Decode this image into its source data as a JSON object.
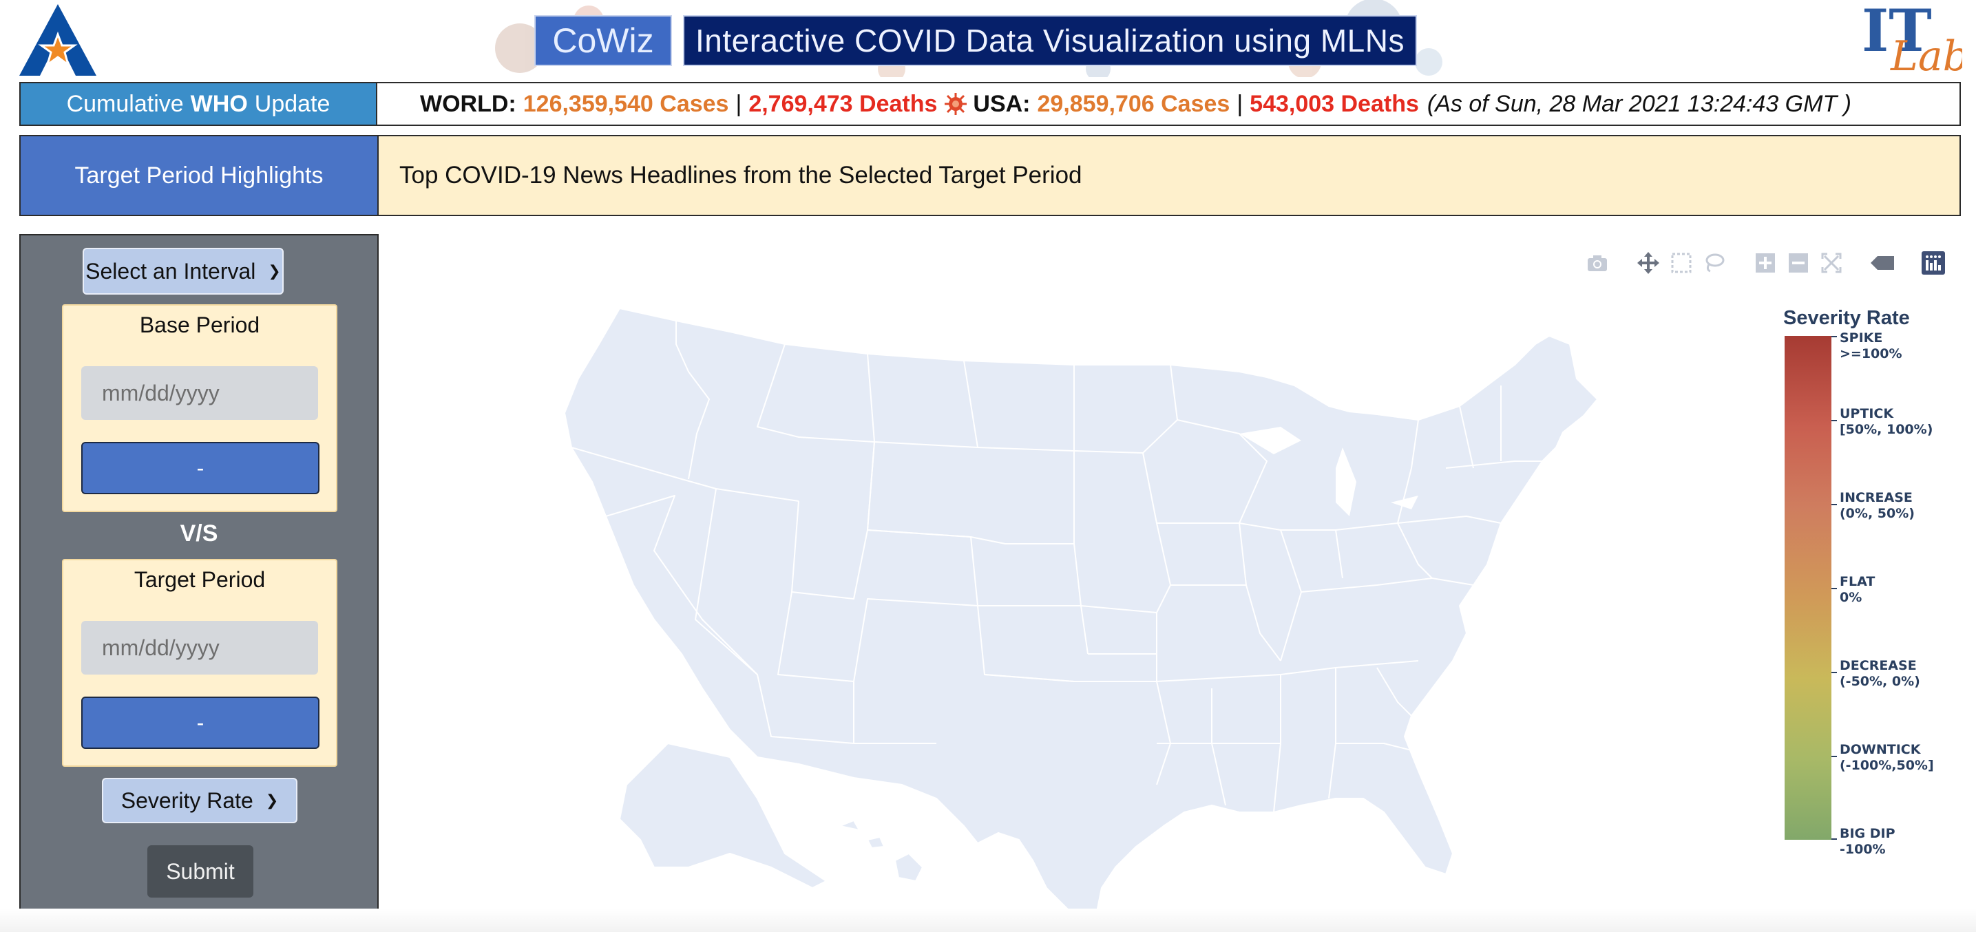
{
  "header": {
    "app_name": "CoWiz",
    "title": "Interactive COVID Data Visualization using MLNs",
    "left_logo": "uta-star-logo",
    "right_logo": "it-lab-logo"
  },
  "who_update": {
    "label_prefix": "Cumulative",
    "label_bold": "WHO",
    "label_suffix": "Update",
    "world_label": "WORLD:",
    "world_cases": "126,359,540 Cases",
    "world_deaths": "2,769,473 Deaths",
    "usa_label": "USA:",
    "usa_cases": "29,859,706 Cases",
    "usa_deaths": "543,003 Deaths",
    "separator": "|",
    "as_of": "(As of Sun, 28 Mar 2021 13:24:43 GMT )",
    "colors": {
      "cases": "#e07a2e",
      "deaths": "#e52b1f"
    }
  },
  "highlights": {
    "label": "Target Period Highlights",
    "text": "Top COVID-19 News Headlines from the Selected Target Period"
  },
  "sidebar": {
    "interval_select": "Select an Interval",
    "base_period": {
      "title": "Base Period",
      "placeholder": "mm/dd/yyyy",
      "button": "-"
    },
    "vs_label": "V/S",
    "target_period": {
      "title": "Target Period",
      "placeholder": "mm/dd/yyyy",
      "button": "-"
    },
    "metric_select": "Severity Rate",
    "submit": "Submit"
  },
  "map": {
    "modebar_icons": [
      "camera-icon",
      "pan-icon",
      "box-select-icon",
      "lasso-select-icon",
      "zoom-in-icon",
      "zoom-out-icon",
      "reset-icon",
      "hover-icon",
      "plotly-logo-icon"
    ],
    "legend": {
      "title": "Severity Rate",
      "items": [
        {
          "name": "SPIKE",
          "range": ">=100%"
        },
        {
          "name": "UPTICK",
          "range": "[50%, 100%)"
        },
        {
          "name": "INCREASE",
          "range": "(0%, 50%)"
        },
        {
          "name": "FLAT",
          "range": "0%"
        },
        {
          "name": "DECREASE",
          "range": "(-50%, 0%)"
        },
        {
          "name": "DOWNTICK",
          "range": "(-100%,50%]"
        },
        {
          "name": "BIG DIP",
          "range": "-100%"
        }
      ],
      "colors": [
        "#a63b33",
        "#c95f50",
        "#cf7d5f",
        "#d09a58",
        "#c9b95a",
        "#a8b967",
        "#82a86a"
      ]
    },
    "state_fill": "#e5ebf6",
    "state_border": "#ffffff"
  }
}
